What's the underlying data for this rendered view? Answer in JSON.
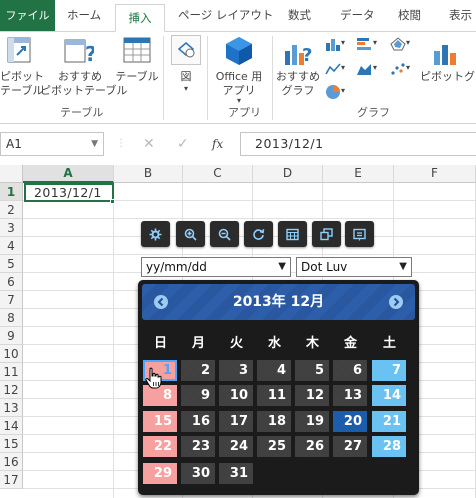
{
  "tabs": {
    "file": "ファイル",
    "home": "ホーム",
    "insert": "挿入",
    "page_layout": "ページ レイアウト",
    "formulas": "数式",
    "data": "データ",
    "review": "校閲",
    "view": "表示"
  },
  "ribbon": {
    "pivot_line1": "ピボット",
    "pivot_line2": "テーブル",
    "rec_pivot_line1": "おすすめ",
    "rec_pivot_line2": "ピボットテーブル",
    "table": "テーブル",
    "group_tables": "テーブル",
    "illustrations": "図",
    "office_apps_line1": "Office 用",
    "office_apps_line2": "アプリ",
    "group_apps": "アプリ",
    "rec_charts_line1": "おすすめ",
    "rec_charts_line2": "グラフ",
    "group_charts": "グラフ",
    "pivot_chart": "ピボットグラ"
  },
  "formula_bar": {
    "name_box": "A1",
    "formula": "2013/12/1"
  },
  "sheet": {
    "columns": [
      "A",
      "B",
      "C",
      "D",
      "E",
      "F"
    ],
    "rows": [
      "1",
      "2",
      "3",
      "4",
      "5",
      "6",
      "7",
      "8",
      "9",
      "10",
      "11",
      "12",
      "13",
      "14",
      "15",
      "16",
      "17"
    ],
    "a1_value": "2013/12/1"
  },
  "picker": {
    "format_value": "yy/mm/dd",
    "theme_value": "Dot Luv",
    "calendar_title": "2013年 12月",
    "weekdays": [
      "日",
      "月",
      "火",
      "水",
      "木",
      "金",
      "土"
    ],
    "weeks": [
      [
        "1",
        "2",
        "3",
        "4",
        "5",
        "6",
        "7"
      ],
      [
        "8",
        "9",
        "10",
        "11",
        "12",
        "13",
        "14"
      ],
      [
        "15",
        "16",
        "17",
        "18",
        "19",
        "20",
        "21"
      ],
      [
        "22",
        "23",
        "24",
        "25",
        "26",
        "27",
        "28"
      ],
      [
        "29",
        "30",
        "31",
        "",
        "",
        "",
        ""
      ]
    ],
    "selected_day": "1",
    "today_day": "20",
    "tool_icons": [
      "gear-icon",
      "zoom-in-icon",
      "zoom-out-icon",
      "refresh-icon",
      "calendar-icon",
      "copy-icon",
      "info-icon"
    ]
  },
  "colors": {
    "excel_green": "#217346",
    "calendar_bg": "#1b1b1b",
    "header_blue": "#2c5ea9",
    "sunday": "#f7a0a0",
    "saturday": "#6ac2f2",
    "today": "#1f63b4"
  }
}
